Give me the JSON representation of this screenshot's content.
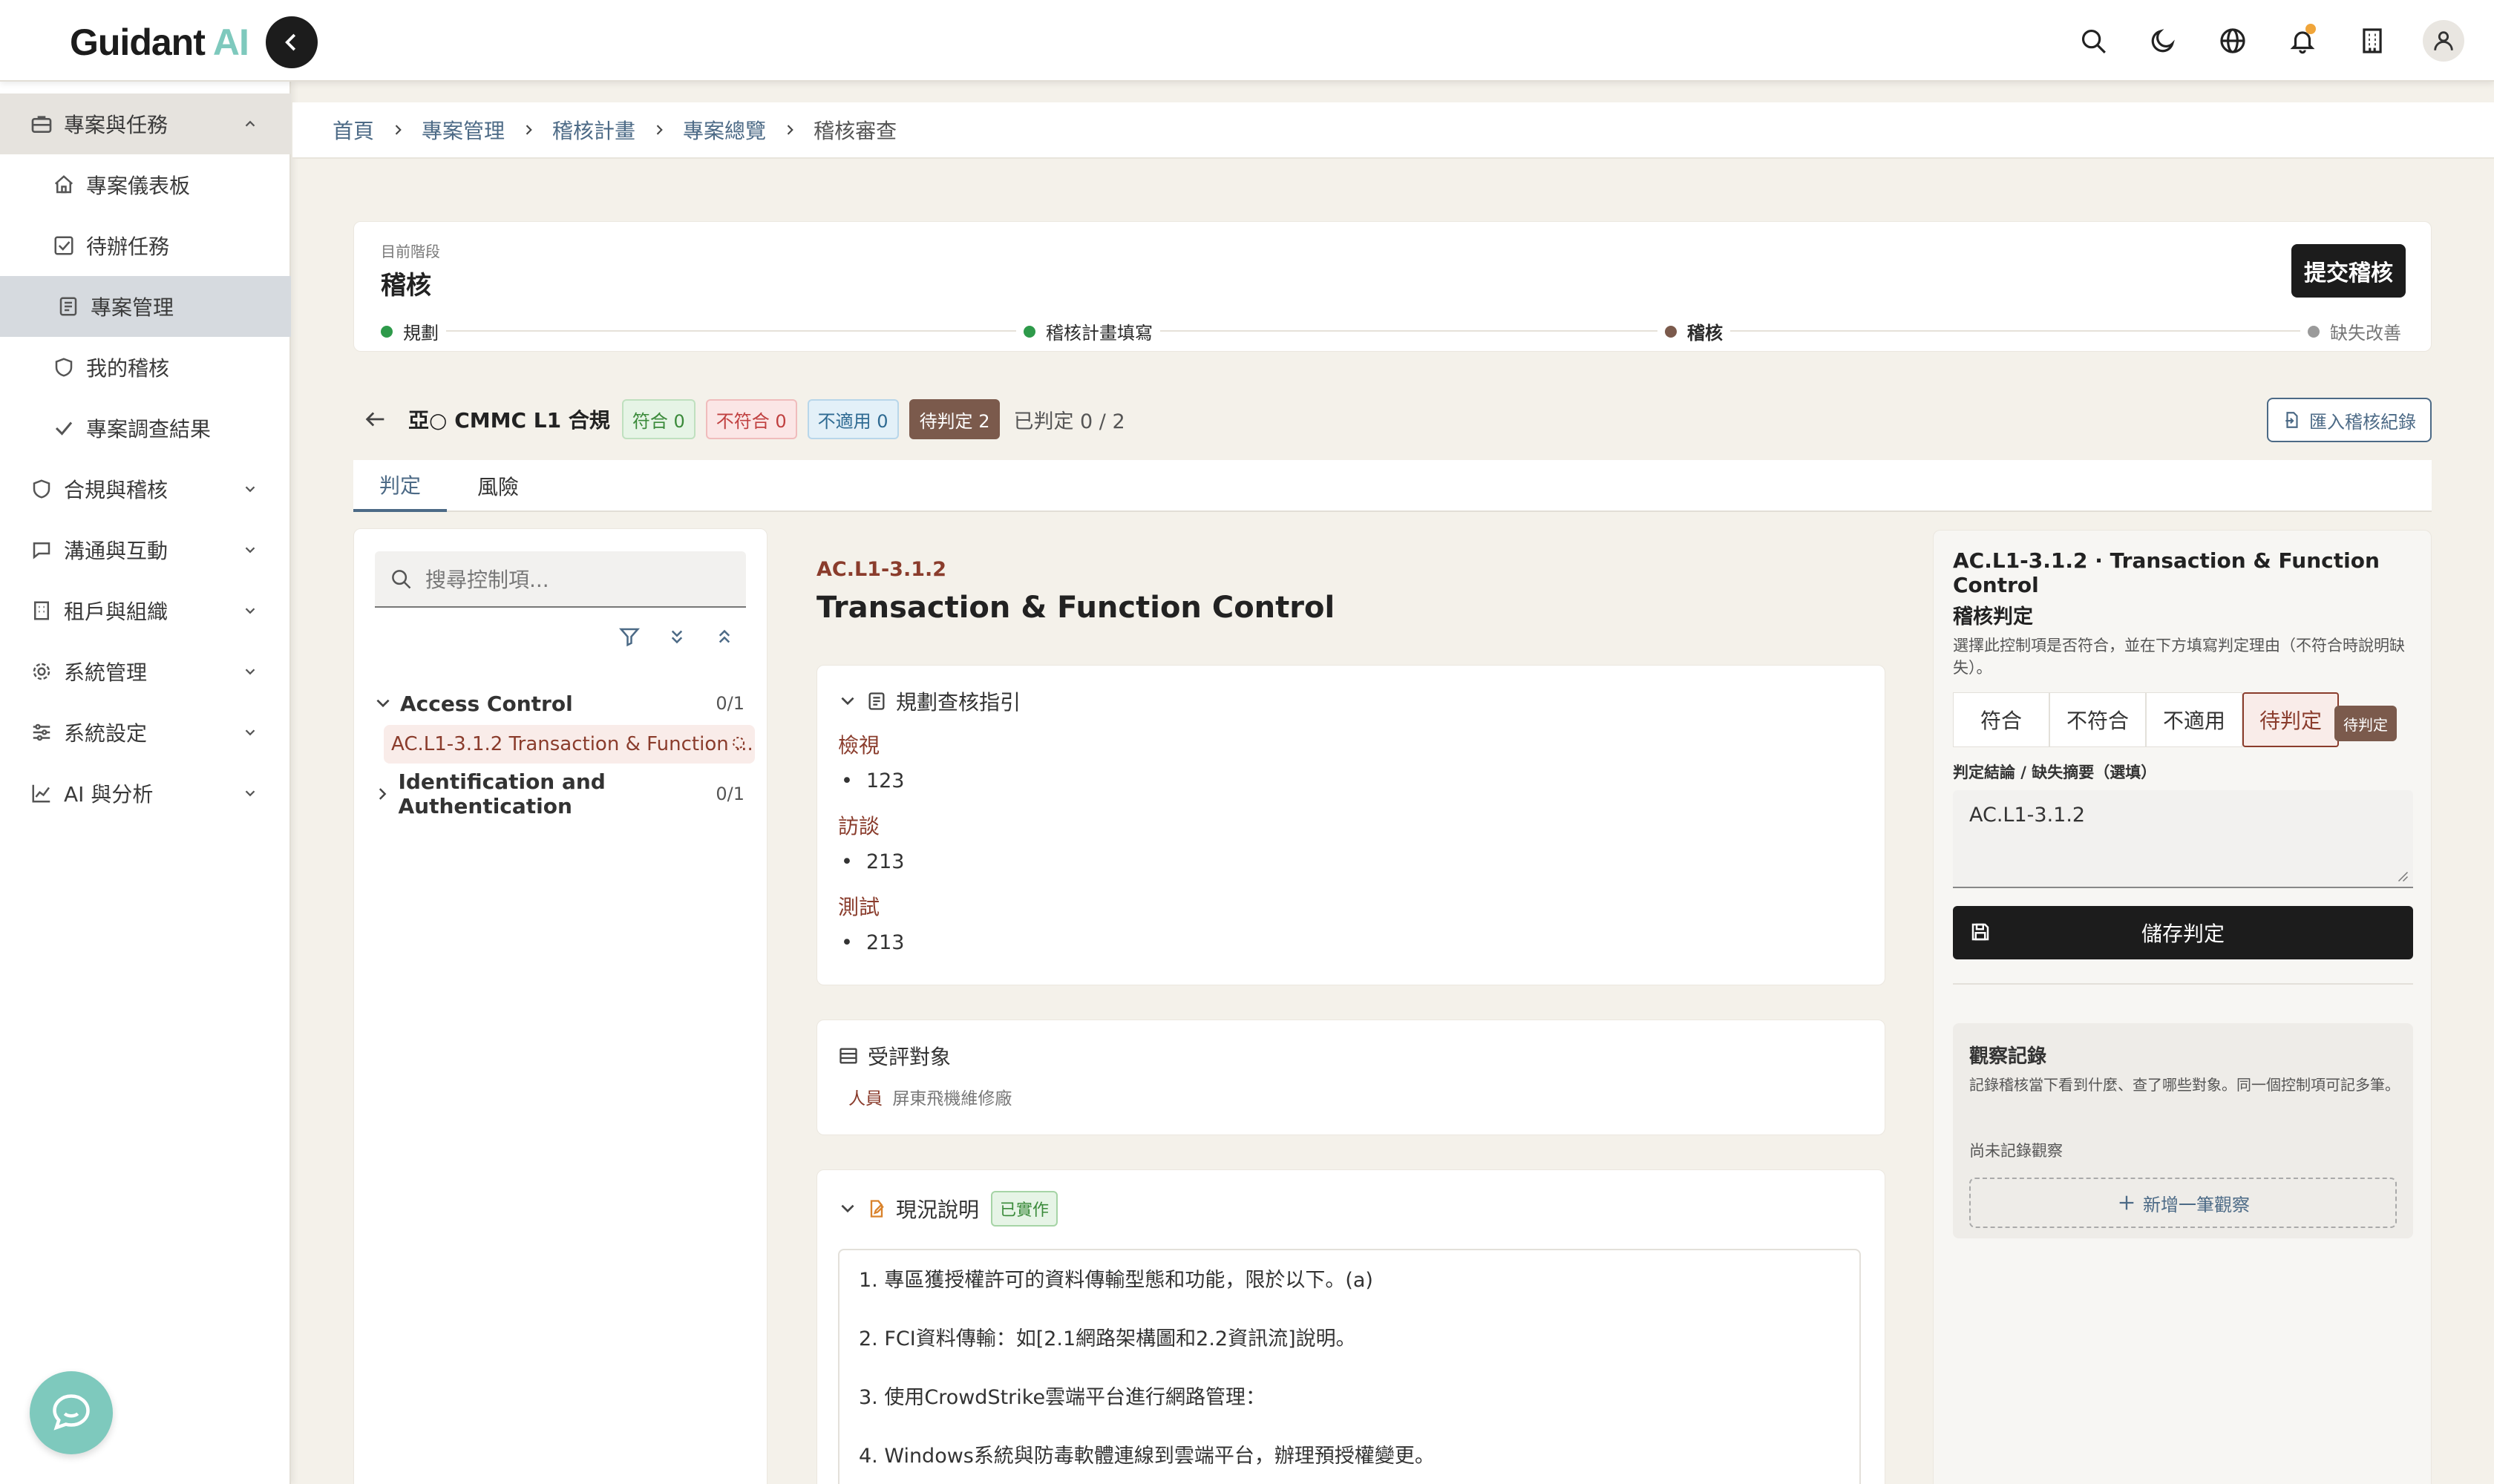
{
  "app": {
    "logo_main": "Guidant",
    "logo_accent": "AI"
  },
  "topbar": {
    "icons": [
      "search-icon",
      "moon-icon",
      "globe-icon",
      "bell-icon",
      "building-icon",
      "user-icon"
    ],
    "notification_dot_color": "#f0a53a"
  },
  "sidebar": {
    "items": [
      {
        "label": "專案與任務",
        "icon": "briefcase-icon",
        "type": "group",
        "expanded": true
      },
      {
        "label": "專案儀表板",
        "icon": "home-icon",
        "type": "sub"
      },
      {
        "label": "待辦任務",
        "icon": "checkbox-icon",
        "type": "sub"
      },
      {
        "label": "專案管理",
        "icon": "document-icon",
        "type": "sub",
        "active": true
      },
      {
        "label": "我的稽核",
        "icon": "shield-icon",
        "type": "sub"
      },
      {
        "label": "專案調查結果",
        "icon": "check-icon",
        "type": "sub"
      },
      {
        "label": "合規與稽核",
        "icon": "shield-icon",
        "type": "group"
      },
      {
        "label": "溝通與互動",
        "icon": "chat-icon",
        "type": "group"
      },
      {
        "label": "租戶與組織",
        "icon": "building-icon",
        "type": "group"
      },
      {
        "label": "系統管理",
        "icon": "gear-icon",
        "type": "group"
      },
      {
        "label": "系統設定",
        "icon": "sliders-icon",
        "type": "group"
      },
      {
        "label": "AI 與分析",
        "icon": "chart-icon",
        "type": "group"
      }
    ]
  },
  "breadcrumb": [
    "首頁",
    "專案管理",
    "稽核計畫",
    "專案總覽",
    "稽核審查"
  ],
  "stage": {
    "label": "目前階段",
    "title": "稽核",
    "submit_label": "提交稽核",
    "steps": [
      {
        "label": "規劃",
        "color": "#2e9a4a"
      },
      {
        "label": "稽核計畫填寫",
        "color": "#2e9a4a"
      },
      {
        "label": "稽核",
        "color": "#7b5a4c"
      },
      {
        "label": "缺失改善",
        "color": "#9a9a9a"
      }
    ]
  },
  "summary": {
    "framework_prefix": "亞○",
    "framework": "CMMC L1 合規",
    "badge_ok": "符合 0",
    "badge_ng": "不符合 0",
    "badge_na": "不適用 0",
    "badge_pending": "待判定 2",
    "judged": "已判定 0 / 2",
    "import_label": "匯入稽核紀錄"
  },
  "tabs": [
    "判定",
    "風險"
  ],
  "tree": {
    "search_placeholder": "搜尋控制項...",
    "groups": [
      {
        "label": "Access Control",
        "count": "0/1",
        "expanded": true
      },
      {
        "label": "Identification and Authentication",
        "count": "0/1",
        "expanded": false
      }
    ],
    "leaf_id": "AC.L1-3.1.2",
    "leaf_label": "Transaction & Function ..."
  },
  "control": {
    "id": "AC.L1-3.1.2",
    "title": "Transaction & Function Control",
    "guide_title": "規劃查核指引",
    "guide": [
      {
        "head": "檢視",
        "items": [
          "123"
        ]
      },
      {
        "head": "訪談",
        "items": [
          "213"
        ]
      },
      {
        "head": "測試",
        "items": [
          "213"
        ]
      }
    ],
    "target_title": "受評對象",
    "target_role": "人員",
    "target_value": "屏東飛機維修廠",
    "status_title": "現況說明",
    "status_badge": "已實作",
    "status_lines": [
      "1. 專區獲授權許可的資料傳輸型態和功能，限於以下。(a)",
      "2. FCI資料傳輸：如[2.1網路架構圖和2.2資訊流]說明。",
      "3. 使用CrowdStrike雲端平台進行網路管理：",
      "4. Windows系統與防毒軟體連線到雲端平台，辦理預授權變更。"
    ]
  },
  "panel": {
    "title": "AC.L1-3.1.2 · Transaction & Function Control",
    "section": "稽核判定",
    "desc": "選擇此控制項是否符合，並在下方填寫判定理由（不符合時說明缺失）。",
    "options": [
      "符合",
      "不符合",
      "不適用",
      "待判定"
    ],
    "selected": "待判定",
    "chip": "待判定",
    "field_label": "判定結論 / 缺失摘要（選填）",
    "field_value": "AC.L1-3.1.2",
    "save_label": "儲存判定",
    "obs_title": "觀察記錄",
    "obs_desc": "記錄稽核當下看到什麼、查了哪些對象。同一個控制項可記多筆。",
    "obs_empty": "尚未記錄觀察",
    "obs_add": "新增一筆觀察"
  }
}
